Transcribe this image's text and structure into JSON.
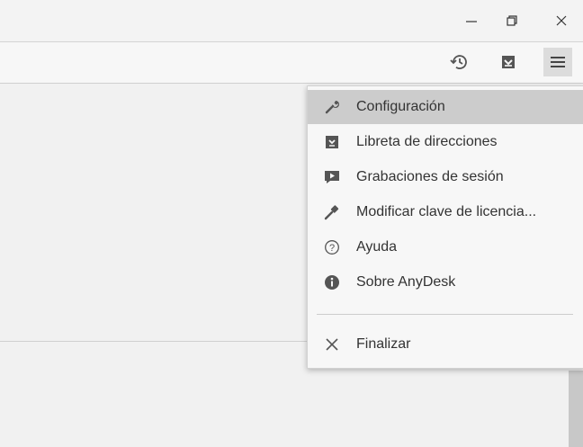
{
  "window": {
    "minimize_icon": "minimize-icon",
    "restore_icon": "restore-icon",
    "close_icon": "close-icon"
  },
  "toolbar": {
    "icons": [
      "history-icon",
      "download-icon",
      "hamburger-menu-icon"
    ]
  },
  "menu": {
    "items": [
      {
        "label": "Configuración",
        "icon": "wrench-icon",
        "highlighted": true
      },
      {
        "label": "Libreta de direcciones",
        "icon": "address-book-icon"
      },
      {
        "label": "Grabaciones de sesión",
        "icon": "recording-icon"
      },
      {
        "label": "Modificar clave de licencia...",
        "icon": "key-icon"
      },
      {
        "label": "Ayuda",
        "icon": "help-icon"
      },
      {
        "label": "Sobre AnyDesk",
        "icon": "info-icon"
      }
    ],
    "exit": {
      "label": "Finalizar",
      "icon": "close-icon"
    }
  },
  "colors": {
    "menu_bg": "#f7f7f7",
    "highlight": "#cccccc",
    "text": "#333333",
    "icon": "#444444"
  }
}
